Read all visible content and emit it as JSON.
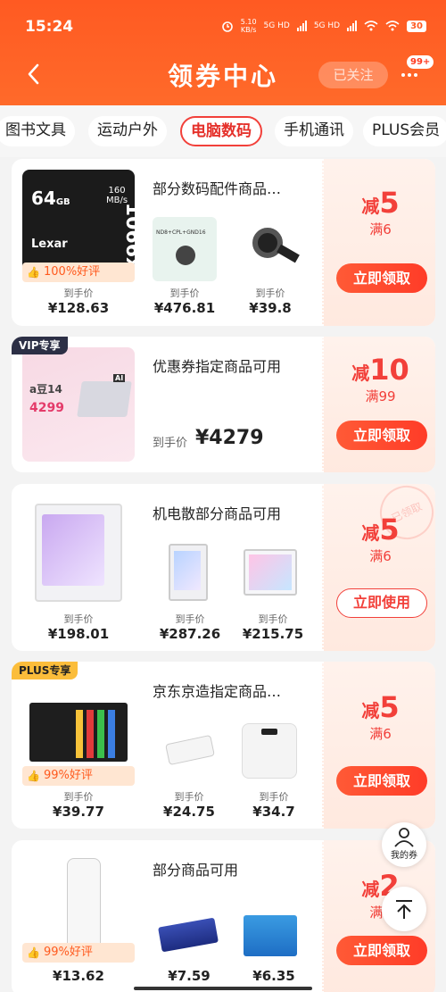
{
  "status": {
    "time": "15:24",
    "net_speed_top": "5.10",
    "net_speed_unit": "KB/s",
    "battery": "30",
    "sig1": "5G HD",
    "sig2": "5G HD"
  },
  "header": {
    "title": "领券中心",
    "follow_label": "已关注",
    "badge": "99+"
  },
  "tabs": [
    "图书文具",
    "运动户外",
    "电脑数码",
    "手机通讯",
    "PLUS会员"
  ],
  "active_tab": "电脑数码",
  "colors": {
    "brand": "#ff5a22",
    "accent_red": "#f2403a"
  },
  "cards": [
    {
      "title": "部分数码配件商品…",
      "good_rate": "100%好评",
      "discount": {
        "minus": "减",
        "amount": "5",
        "condition": "满6"
      },
      "cta": "立即领取",
      "products": [
        {
          "label": "到手价",
          "price": "¥128.63"
        },
        {
          "label": "到手价",
          "price": "¥476.81"
        },
        {
          "label": "到手价",
          "price": "¥39.8"
        }
      ],
      "main_img_text": {
        "capacity": "64",
        "unit": "GB",
        "speed": "160",
        "speed_unit": "MB/s",
        "brand": "Lexar",
        "model": "1066x"
      },
      "thumb2_text": "ND8+CPL+GND16"
    },
    {
      "tag": "VIP专享",
      "title": "优惠券指定商品可用",
      "price_label": "到手价",
      "price": "¥4279",
      "discount": {
        "minus": "减",
        "amount": "10",
        "condition": "满99"
      },
      "cta": "立即领取",
      "main_img_text": {
        "product": "a豆14",
        "price": "4299",
        "badge": "AI"
      }
    },
    {
      "title": "机电散部分商品可用",
      "discount": {
        "minus": "减",
        "amount": "5",
        "condition": "满6"
      },
      "cta": "立即使用",
      "stamp": "已领取",
      "products": [
        {
          "label": "到手价",
          "price": "¥198.01"
        },
        {
          "label": "到手价",
          "price": "¥287.26"
        },
        {
          "label": "到手价",
          "price": "¥215.75"
        }
      ]
    },
    {
      "tag": "PLUS专享",
      "title": "京东京造指定商品…",
      "good_rate": "99%好评",
      "discount": {
        "minus": "减",
        "amount": "5",
        "condition": "满6"
      },
      "cta": "立即领取",
      "products": [
        {
          "label": "到手价",
          "price": "¥39.77"
        },
        {
          "label": "到手价",
          "price": "¥24.75"
        },
        {
          "label": "到手价",
          "price": "¥34.7"
        }
      ]
    },
    {
      "title": "部分商品可用",
      "good_rate": "99%好评",
      "discount": {
        "minus": "减",
        "amount": "2",
        "condition": "满9"
      },
      "cta": "立即领取",
      "products": [
        {
          "label": "",
          "price": "¥13.62"
        },
        {
          "label": "",
          "price": "¥7.59"
        },
        {
          "label": "",
          "price": "¥6.35"
        }
      ]
    }
  ],
  "floating": {
    "my_coupons": "我的券"
  }
}
